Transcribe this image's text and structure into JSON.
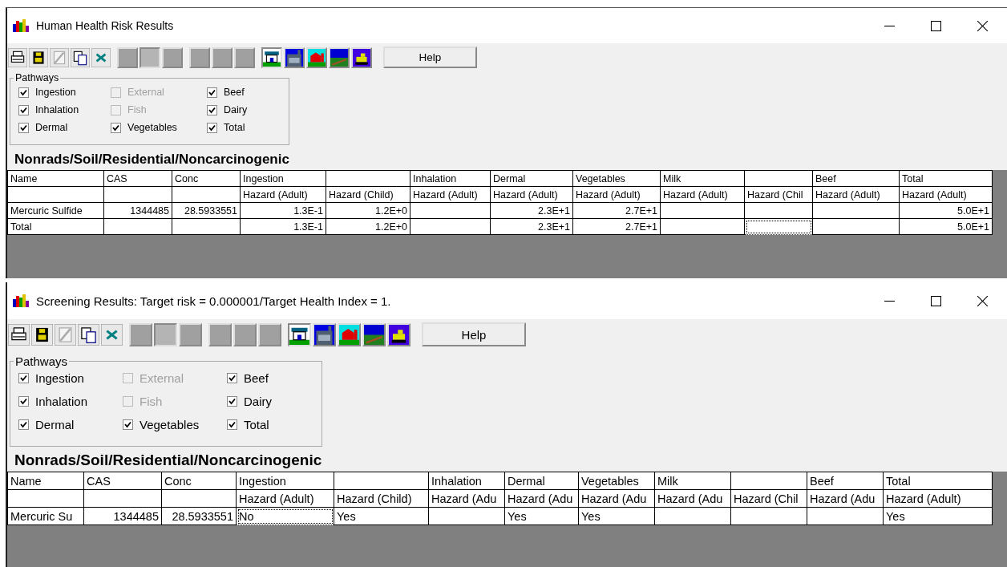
{
  "windows": [
    {
      "title": "Human Health Risk Results",
      "view_buttons": [
        {
          "selected": false
        },
        {
          "selected": true
        },
        {
          "selected": false
        },
        {
          "selected": false
        },
        {
          "selected": false
        },
        {
          "selected": false
        }
      ],
      "site_buttons": [
        {
          "selected": true
        },
        {
          "selected": false
        },
        {
          "selected": false
        },
        {
          "selected": false
        },
        {
          "selected": false
        }
      ],
      "help": "Help",
      "pathways": {
        "title": "Pathways",
        "items": [
          {
            "label": "Ingestion",
            "checked": true,
            "disabled": false
          },
          {
            "label": "External",
            "checked": false,
            "disabled": true
          },
          {
            "label": "Beef",
            "checked": true,
            "disabled": false
          },
          {
            "label": "Inhalation",
            "checked": true,
            "disabled": false
          },
          {
            "label": "Fish",
            "checked": false,
            "disabled": true
          },
          {
            "label": "Dairy",
            "checked": true,
            "disabled": false
          },
          {
            "label": "Dermal",
            "checked": true,
            "disabled": false
          },
          {
            "label": "Vegetables",
            "checked": true,
            "disabled": false
          },
          {
            "label": "Total",
            "checked": true,
            "disabled": false
          }
        ]
      },
      "heading": "Nonrads/Soil/Residential/Noncarcinogenic",
      "table": {
        "kind": "numeric",
        "columns": [
          {
            "heading": "Name"
          },
          {
            "heading": "CAS"
          },
          {
            "heading": "Conc"
          },
          {
            "heading": "Ingestion",
            "subheading": "Hazard (Adult)"
          },
          {
            "subheading": "Hazard (Child)"
          },
          {
            "heading": "Inhalation",
            "subheading": "Hazard (Adult)"
          },
          {
            "heading": "Dermal",
            "subheading": "Hazard (Adult)"
          },
          {
            "heading": "Vegetables",
            "subheading": "Hazard (Adult)"
          },
          {
            "heading": "Milk",
            "subheading": "Hazard (Adult)"
          },
          {
            "subheading": "Hazard (Chil"
          },
          {
            "heading": "Beef",
            "subheading": "Hazard (Adult)"
          },
          {
            "heading": "Total",
            "subheading": "Hazard (Adult)"
          }
        ],
        "rows": [
          [
            {
              "text": "Mercuric Sulfide",
              "focused": false
            },
            {
              "text": "1344485",
              "focused": false
            },
            {
              "text": "28.5933551",
              "focused": false
            },
            {
              "text": "1.3E-1",
              "focused": false
            },
            {
              "text": "1.2E+0",
              "focused": false
            },
            {
              "focused": false
            },
            {
              "text": "2.3E+1",
              "focused": false
            },
            {
              "text": "2.7E+1",
              "focused": false
            },
            {
              "focused": false
            },
            {
              "focused": false
            },
            {
              "focused": false
            },
            {
              "text": "5.0E+1",
              "focused": false
            }
          ],
          [
            {
              "text": "Total",
              "focused": false
            },
            {
              "focused": false
            },
            {
              "focused": false
            },
            {
              "text": "1.3E-1",
              "focused": false
            },
            {
              "text": "1.2E+0",
              "focused": false
            },
            {
              "focused": false
            },
            {
              "text": "2.3E+1",
              "focused": false
            },
            {
              "text": "2.7E+1",
              "focused": false
            },
            {
              "focused": false
            },
            {
              "focused": true
            },
            {
              "focused": false
            },
            {
              "text": "5.0E+1",
              "focused": false
            }
          ]
        ]
      }
    },
    {
      "title": "Screening Results: Target risk = 0.000001/Target Health Index = 1.",
      "view_buttons": [
        {
          "selected": false
        },
        {
          "selected": true
        },
        {
          "selected": false
        },
        {
          "selected": false
        },
        {
          "selected": false
        },
        {
          "selected": false
        }
      ],
      "site_buttons": [
        {
          "selected": true
        },
        {
          "selected": false
        },
        {
          "selected": false
        },
        {
          "selected": false
        },
        {
          "selected": false
        }
      ],
      "help": "Help",
      "pathways": {
        "title": "Pathways",
        "items": [
          {
            "label": "Ingestion",
            "checked": true,
            "disabled": false
          },
          {
            "label": "External",
            "checked": false,
            "disabled": true
          },
          {
            "label": "Beef",
            "checked": true,
            "disabled": false
          },
          {
            "label": "Inhalation",
            "checked": true,
            "disabled": false
          },
          {
            "label": "Fish",
            "checked": false,
            "disabled": true
          },
          {
            "label": "Dairy",
            "checked": true,
            "disabled": false
          },
          {
            "label": "Dermal",
            "checked": true,
            "disabled": false
          },
          {
            "label": "Vegetables",
            "checked": true,
            "disabled": false
          },
          {
            "label": "Total",
            "checked": true,
            "disabled": false
          }
        ]
      },
      "heading": "Nonrads/Soil/Residential/Noncarcinogenic",
      "table": {
        "kind": "flag",
        "columns": [
          {
            "heading": "Name"
          },
          {
            "heading": "CAS"
          },
          {
            "heading": "Conc"
          },
          {
            "heading": "Ingestion",
            "subheading": "Hazard (Adult)"
          },
          {
            "subheading": "Hazard (Child)"
          },
          {
            "heading": "Inhalation",
            "subheading": "Hazard (Adu"
          },
          {
            "heading": "Dermal",
            "subheading": "Hazard (Adu"
          },
          {
            "heading": "Vegetables",
            "subheading": "Hazard (Adu"
          },
          {
            "heading": "Milk",
            "subheading": "Hazard (Adu"
          },
          {
            "subheading": "Hazard (Chil"
          },
          {
            "heading": "Beef",
            "subheading": "Hazard (Adu"
          },
          {
            "heading": "Total",
            "subheading": "Hazard (Adult)"
          }
        ],
        "rows": [
          [
            {
              "text": "Mercuric Su",
              "focused": false
            },
            {
              "text": "1344485",
              "focused": false
            },
            {
              "text": "28.5933551",
              "focused": false
            },
            {
              "text": "No",
              "focused": true
            },
            {
              "text": "Yes",
              "focused": false
            },
            {
              "focused": false
            },
            {
              "text": "Yes",
              "focused": false
            },
            {
              "text": "Yes",
              "focused": false
            },
            {
              "focused": false
            },
            {
              "focused": false
            },
            {
              "focused": false
            },
            {
              "text": "Yes",
              "focused": false
            }
          ]
        ]
      }
    }
  ]
}
